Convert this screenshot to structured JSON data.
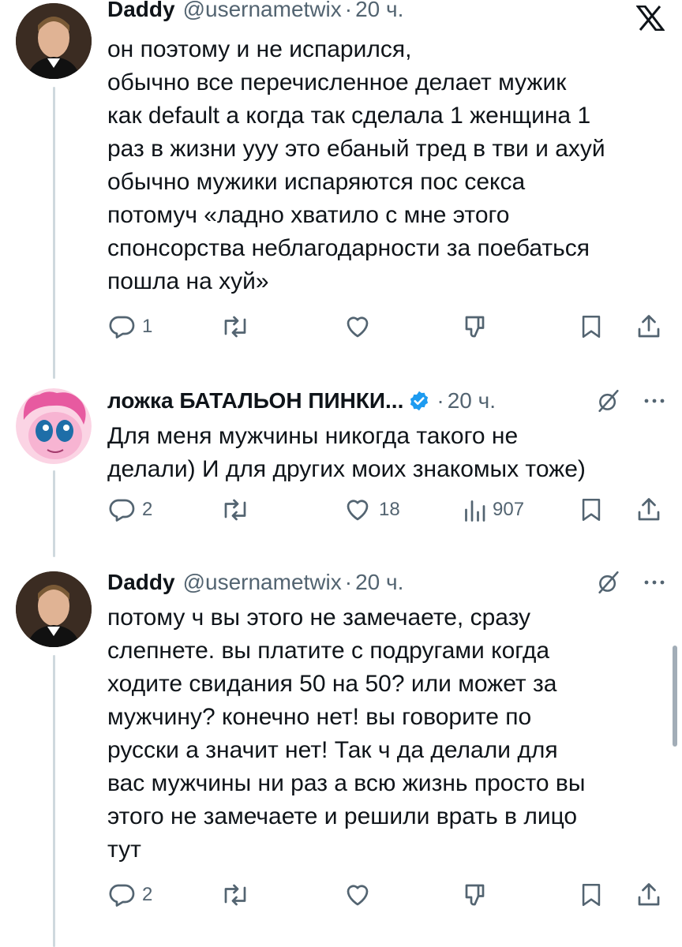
{
  "tweets": [
    {
      "name": "Daddy",
      "handle": "@usernametwix",
      "separator": "·",
      "time": "20 ч.",
      "lines": [
        "он поэтому и не испарился,",
        "обычно все перечисленное делает мужик",
        "как default а когда так сделала 1 женщина 1",
        "раз в жизни ууу это ебаный тред в тви и ахуй",
        "обычно мужики испаряются пос секса",
        "потомуч «ладно хватило с мне этого",
        "спонсорства неблагодарности за поебаться",
        "пошла на хуй»"
      ],
      "reply_count": "1"
    },
    {
      "name": "ложка БАТАЛЬОН ПИНКИ...",
      "verified": true,
      "separator": "·",
      "time": "20 ч.",
      "lines": [
        "Для меня мужчины никогда такого не",
        "делали) И для других моих знакомых тоже)"
      ],
      "reply_count": "2",
      "like_count": "18",
      "view_count": "907"
    },
    {
      "name": "Daddy",
      "handle": "@usernametwix",
      "separator": "·",
      "time": "20 ч.",
      "lines": [
        "потому ч вы этого не замечаете, сразу",
        "слепнете. вы платите с подругами когда",
        "ходите свидания 50 на 50? или может за",
        "мужчину? конечно нет! вы говорите по",
        "русски а значит нет! Так ч да делали для",
        "вас мужчины ни раз а всю жизнь просто вы",
        "этого не замечаете и решили врать в лицо",
        "тут"
      ],
      "reply_count": "2"
    }
  ],
  "colors": {
    "text": "#0f1419",
    "secondary": "#536471",
    "thread_line": "#cfd9de",
    "verified": "#1d9bf0"
  },
  "icons": [
    "x-logo-icon",
    "reply-icon",
    "retweet-icon",
    "like-icon",
    "dislike-icon",
    "views-icon",
    "bookmark-icon",
    "share-icon",
    "grok-icon",
    "more-icon",
    "verified-badge-icon"
  ]
}
